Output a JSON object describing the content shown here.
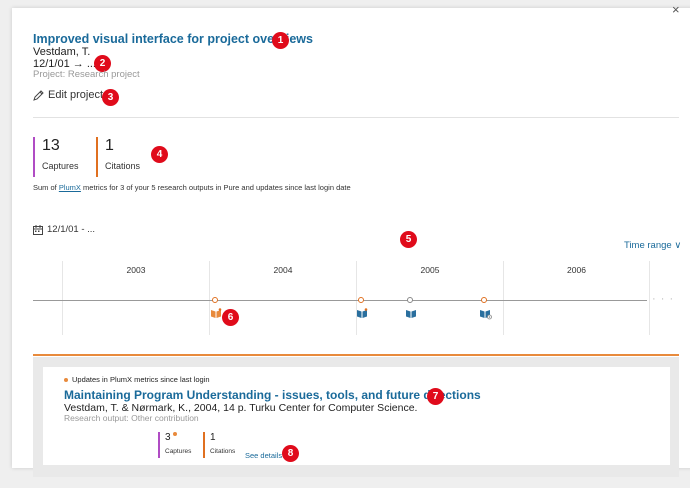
{
  "project": {
    "title": "Improved visual interface for project overviews",
    "author": "Vestdam, T.",
    "date": "12/1/01 → ...",
    "type": "Project: Research project",
    "edit_label": "Edit project"
  },
  "metrics": {
    "captures_value": "13",
    "captures_label": "Captures",
    "citations_value": "1",
    "citations_label": "Citations",
    "captures_color": "#b04cc4",
    "citations_color": "#e07020"
  },
  "summary": {
    "prefix": "Sum of ",
    "link": "PlumX",
    "suffix": " metrics for 3 of your 5 research outputs in Pure and updates since last login date"
  },
  "timeline": {
    "date_range": "12/1/01 - ...",
    "time_range_label": "Time range",
    "years": [
      "2003",
      "2004",
      "2005",
      "2006"
    ],
    "more": "· · ·"
  },
  "update": {
    "header": "Updates in PlumX metrics since last login",
    "title": "Maintaining Program Understanding - issues, tools, and future directions",
    "description": "Vestdam, T. & Nørmark, K., 2004, 14 p. Turku Center for Computer Science.",
    "type": "Research output: Other contribution",
    "captures_value": "3",
    "captures_label": "Captures",
    "citations_value": "1",
    "citations_label": "Citations",
    "see_details": "See details"
  },
  "callouts": [
    "1",
    "2",
    "3",
    "4",
    "5",
    "6",
    "7",
    "8"
  ],
  "close": "×",
  "colors": {
    "accent": "#1a6a9a",
    "callout": "#e00b1b",
    "orange": "#e88a3c"
  }
}
